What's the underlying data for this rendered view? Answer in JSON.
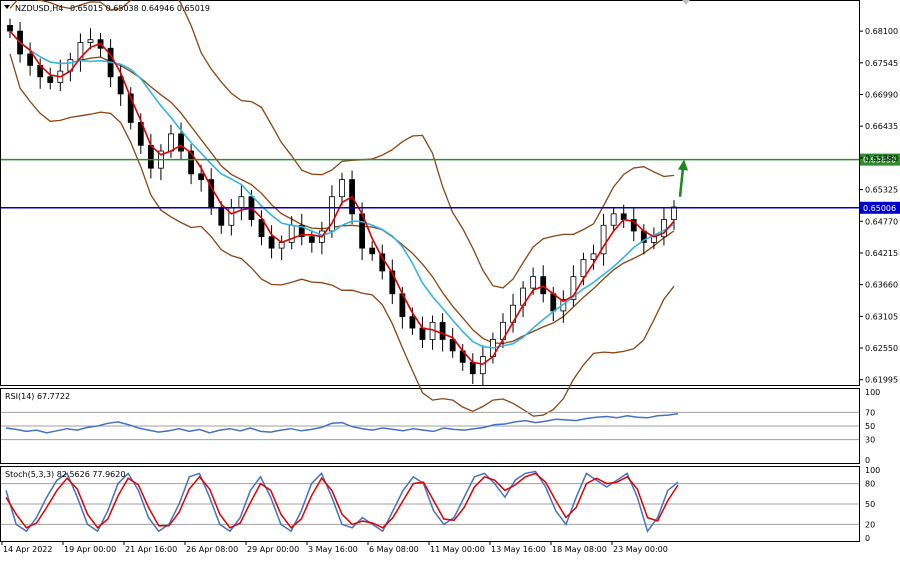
{
  "header": {
    "symbol": "NZDUSD,H4",
    "ohlc": "0.65015 0.65038 0.64946 0.65019"
  },
  "rsi_panel": {
    "title": "RSI(14) 67.7722"
  },
  "stoch_panel": {
    "title": "Stoch(5,3,3) 82.5626 77.9620"
  },
  "colors": {
    "background": "#ffffff",
    "candle": "#000000",
    "bollinger": "#8b4513",
    "ma_fast": "#e00000",
    "ma_slow": "#33b5e5",
    "resistance_line": "#2e8b2e",
    "price_line": "#0000cc",
    "arrow": "#1a8a1a",
    "indicator_main": "#4472c4",
    "indicator_signal": "#e00000",
    "level_line": "#a0a0a0"
  },
  "chart_data": [
    {
      "type": "candlestick",
      "name": "NZDUSD,H4",
      "price_ticks": [
        0.681,
        0.67545,
        0.6699,
        0.66435,
        0.6588,
        0.65325,
        0.6477,
        0.64215,
        0.6366,
        0.63105,
        0.6255,
        0.61995
      ],
      "price_tick_labels": [
        "0.68100",
        "0.67545",
        "0.66990",
        "0.66435",
        "0.65880",
        "0.65325",
        "0.64770",
        "0.64215",
        "0.63660",
        "0.63105",
        "0.62550",
        "0.61995"
      ],
      "ylim": [
        0.6192,
        0.684
      ],
      "x_tick_labels": [
        "14 Apr 2022",
        "19 Apr 00:00",
        "21 Apr 16:00",
        "26 Apr 08:00",
        "29 Apr 00:00",
        "3 May 16:00",
        "6 May 08:00",
        "11 May 00:00",
        "13 May 16:00",
        "18 May 08:00",
        "23 May 00:00"
      ],
      "horizontal_lines": [
        {
          "label": "0.65850",
          "value": 0.6585,
          "role": "resistance"
        },
        {
          "label": "0.65006",
          "value": 0.65006,
          "role": "current price"
        }
      ],
      "close_path": [
        0.681,
        0.677,
        0.675,
        0.673,
        0.672,
        0.674,
        0.676,
        0.679,
        0.6795,
        0.678,
        0.673,
        0.67,
        0.665,
        0.661,
        0.657,
        0.66,
        0.663,
        0.66,
        0.656,
        0.655,
        0.65,
        0.647,
        0.65,
        0.652,
        0.648,
        0.645,
        0.643,
        0.644,
        0.647,
        0.645,
        0.644,
        0.646,
        0.652,
        0.655,
        0.649,
        0.643,
        0.642,
        0.639,
        0.635,
        0.631,
        0.629,
        0.627,
        0.63,
        0.627,
        0.625,
        0.623,
        0.621,
        0.624,
        0.627,
        0.63,
        0.633,
        0.636,
        0.638,
        0.635,
        0.632,
        0.634,
        0.638,
        0.641,
        0.642,
        0.647,
        0.649,
        0.648,
        0.646,
        0.644,
        0.645,
        0.648,
        0.6502
      ],
      "trend_arrow": {
        "from": 0.652,
        "to": 0.658
      }
    },
    {
      "type": "line",
      "name": "RSI(14)",
      "value": 67.7722,
      "ylim": [
        0,
        100
      ],
      "levels": [
        70,
        50,
        30
      ],
      "level_labels": [
        "100",
        "70",
        "50",
        "30",
        "0"
      ],
      "values": [
        47,
        45,
        42,
        44,
        40,
        43,
        46,
        44,
        48,
        50,
        54,
        56,
        52,
        47,
        44,
        41,
        43,
        46,
        42,
        45,
        40,
        44,
        46,
        43,
        47,
        42,
        41,
        44,
        46,
        43,
        45,
        48,
        54,
        55,
        49,
        46,
        44,
        47,
        45,
        43,
        46,
        44,
        42,
        47,
        45,
        44,
        46,
        48,
        52,
        53,
        56,
        58,
        55,
        57,
        60,
        59,
        58,
        61,
        63,
        64,
        62,
        65,
        63,
        62,
        65,
        66,
        68
      ]
    },
    {
      "type": "line",
      "name": "Stoch(5,3,3)",
      "main_value": 82.5626,
      "signal_value": 77.962,
      "ylim": [
        0,
        100
      ],
      "levels": [
        80,
        50,
        20
      ],
      "level_labels": [
        "100",
        "80",
        "50",
        "20",
        "0"
      ],
      "main": [
        70,
        20,
        10,
        30,
        60,
        85,
        95,
        60,
        20,
        10,
        40,
        80,
        95,
        70,
        30,
        10,
        20,
        50,
        90,
        95,
        60,
        20,
        10,
        30,
        70,
        90,
        60,
        20,
        10,
        40,
        80,
        95,
        60,
        20,
        15,
        30,
        20,
        10,
        40,
        70,
        90,
        80,
        40,
        20,
        30,
        60,
        90,
        95,
        80,
        60,
        85,
        95,
        98,
        75,
        40,
        20,
        60,
        95,
        85,
        75,
        85,
        95,
        60,
        10,
        30,
        70,
        82
      ],
      "signal": [
        60,
        35,
        15,
        22,
        45,
        70,
        88,
        72,
        35,
        15,
        28,
        62,
        88,
        78,
        45,
        18,
        18,
        38,
        72,
        90,
        72,
        35,
        15,
        22,
        52,
        80,
        70,
        35,
        15,
        28,
        62,
        88,
        70,
        35,
        20,
        25,
        22,
        15,
        30,
        55,
        80,
        82,
        55,
        28,
        26,
        45,
        75,
        90,
        85,
        70,
        78,
        90,
        95,
        82,
        55,
        30,
        45,
        80,
        88,
        80,
        82,
        90,
        72,
        30,
        25,
        55,
        78
      ]
    }
  ]
}
